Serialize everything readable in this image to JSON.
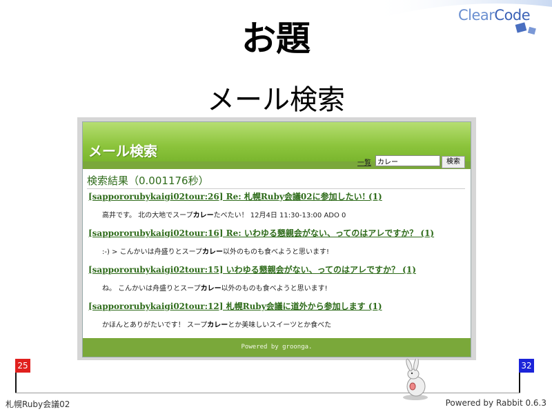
{
  "slide": {
    "title": "お題",
    "subtitle": "メール検索",
    "logo_prefix": "Clear",
    "logo_suffix": "Code"
  },
  "app": {
    "title": "メール検索",
    "list_link": "一覧",
    "search_value": "カレー",
    "search_button": "検索",
    "results_heading": "検索結果（0.001176秒）",
    "results": [
      {
        "title": "[sappororubykaigi02tour:26] Re: 札幌Ruby会議02に参加したい! (1)",
        "snippet_pre": "高井です。 北の大地でスープ",
        "snippet_hl": "カレー",
        "snippet_post": "たべたい！ 12月4日 11:30-13:00 ADO 0"
      },
      {
        "title": "[sappororubykaigi02tour:16] Re: いわゆる懇親会がない、ってのはアレですか？ (1)",
        "snippet_pre": ":-) > こんかいは舟盛りとスープ",
        "snippet_hl": "カレー",
        "snippet_post": "以外のものも食べようと思います!"
      },
      {
        "title": "[sappororubykaigi02tour:15] いわゆる懇親会がない、ってのはアレですか？ (1)",
        "snippet_pre": "ね。 こんかいは舟盛りとスープ",
        "snippet_hl": "カレー",
        "snippet_post": "以外のものも食べようと思います!"
      },
      {
        "title": "[sappororubykaigi02tour:12] 札幌Ruby会議に道外から参加します (1)",
        "snippet_pre": "かほんとありがたいです！ スープ",
        "snippet_hl": "カレー",
        "snippet_post": "とか美味しいスイーツとか食べた"
      }
    ],
    "footer": "Powered by groonga."
  },
  "progress": {
    "current_page": "25",
    "total_pages": "32",
    "fraction": 0.78
  },
  "footer": {
    "left": "札幌Ruby会議02",
    "right": "Powered by Rabbit 0.6.3"
  },
  "colors": {
    "accent_green": "#7aa83a",
    "link_green": "#2e6b1a",
    "start_flag": "#e0201e",
    "end_flag": "#1b24d9"
  }
}
